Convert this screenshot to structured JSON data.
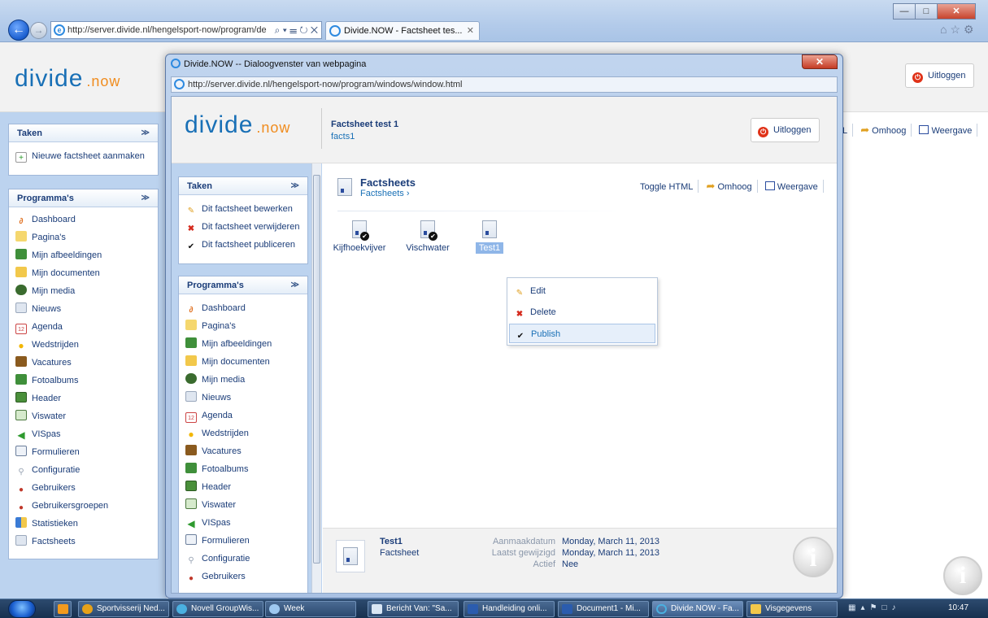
{
  "browser": {
    "url": "http://server.divide.nl/hengelsport-now/program/de",
    "url_host": "divide.nl",
    "tab_title": "Divide.NOW - Factsheet tes...",
    "addr_controls": "⌕ ▾ ☰ ↻ ✕"
  },
  "background": {
    "logo": "divide",
    "logo_dot": ".now",
    "logout": "Uitloggen",
    "taken": {
      "title": "Taken",
      "items": [
        "Nieuwe factsheet aanmaken"
      ]
    },
    "programmas": {
      "title": "Programma's",
      "items": [
        "Dashboard",
        "Pagina's",
        "Mijn afbeeldingen",
        "Mijn documenten",
        "Mijn media",
        "Nieuws",
        "Agenda",
        "Wedstrijden",
        "Vacatures",
        "Fotoalbums",
        "Header",
        "Viswater",
        "VISpas",
        "Formulieren",
        "Configuratie",
        "Gebruikers",
        "Gebruikersgroepen",
        "Statistieken",
        "Factsheets"
      ]
    },
    "tools": {
      "cut": "L",
      "omhoog": "Omhoog",
      "weergave": "Weergave"
    }
  },
  "dialog": {
    "title": "Divide.NOW -- Dialoogvenster van webpagina",
    "url": "http://server.divide.nl/hengelsport-now/program/windows/window.html",
    "header": {
      "title": "Factsheet test 1",
      "subtitle": "facts1",
      "logout": "Uitloggen"
    },
    "taken": {
      "title": "Taken",
      "items": [
        "Dit factsheet bewerken",
        "Dit factsheet verwijderen",
        "Dit factsheet publiceren"
      ]
    },
    "programmas": {
      "title": "Programma's",
      "items": [
        "Dashboard",
        "Pagina's",
        "Mijn afbeeldingen",
        "Mijn documenten",
        "Mijn media",
        "Nieuws",
        "Agenda",
        "Wedstrijden",
        "Vacatures",
        "Fotoalbums",
        "Header",
        "Viswater",
        "VISpas",
        "Formulieren",
        "Configuratie",
        "Gebruikers"
      ]
    },
    "main": {
      "title": "Factsheets",
      "breadcrumb": "Factsheets  ›",
      "toggle_html": "Toggle HTML",
      "omhoog": "Omhoog",
      "weergave": "Weergave",
      "files": [
        "Kijfhoekvijver",
        "Vischwater",
        "Test1"
      ]
    },
    "context_menu": {
      "edit": "Edit",
      "delete": "Delete",
      "publish": "Publish"
    },
    "footer": {
      "name": "Test1",
      "type": "Factsheet",
      "created_label": "Aanmaakdatum",
      "created_value": "Monday, March 11, 2013",
      "modified_label": "Laatst gewijzigd",
      "modified_value": "Monday, March 11, 2013",
      "active_label": "Actief",
      "active_value": "Nee"
    }
  },
  "taskbar": {
    "items": [
      "Sportvisserij Ned...",
      "Novell GroupWis...",
      "Week",
      "Bericht Van: \"Sa...",
      "Handleiding onli...",
      "Document1 - Mi...",
      "Divide.NOW - Fa...",
      "Visgegevens"
    ],
    "clock": "10:47"
  }
}
